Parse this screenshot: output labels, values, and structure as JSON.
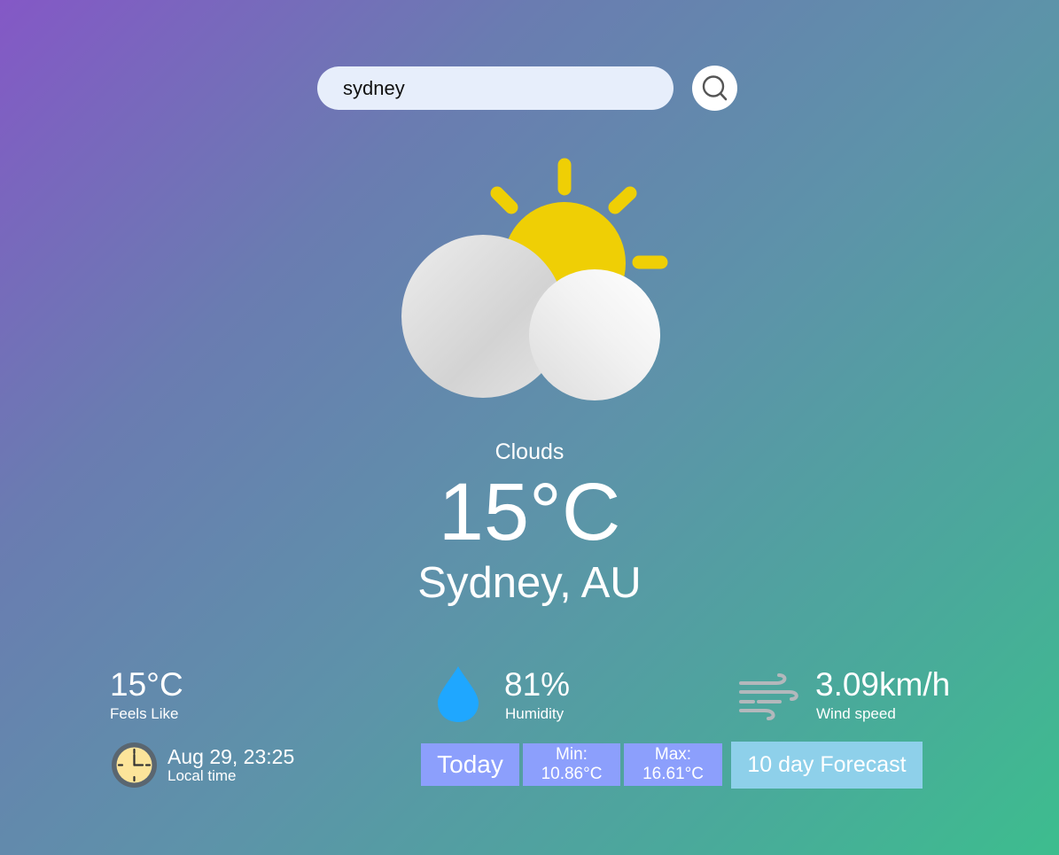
{
  "search": {
    "value": "sydney"
  },
  "weather": {
    "condition": "Clouds",
    "temperature": "15°C",
    "location": "Sydney, AU"
  },
  "details": {
    "feels_like": {
      "value": "15°C",
      "label": "Feels Like"
    },
    "humidity": {
      "value": "81%",
      "label": "Humidity"
    },
    "wind": {
      "value": "3.09km/h",
      "label": "Wind speed"
    },
    "local_time": {
      "value": "Aug 29, 23:25",
      "label": "Local time"
    }
  },
  "today": {
    "label": "Today",
    "min_label": "Min:",
    "min_value": "10.86°C",
    "max_label": "Max:",
    "max_value": "16.61°C"
  },
  "forecast_button": "10 day Forecast",
  "icons": {
    "search": "search-icon",
    "weather": "partly-cloudy-icon",
    "humidity": "water-drop-icon",
    "wind": "wind-icon",
    "clock": "clock-icon"
  },
  "colors": {
    "pill": "#8c9ffc",
    "forecast_button": "#8ed0ea",
    "sun": "#efcf05",
    "drop": "#1fa7ff"
  }
}
